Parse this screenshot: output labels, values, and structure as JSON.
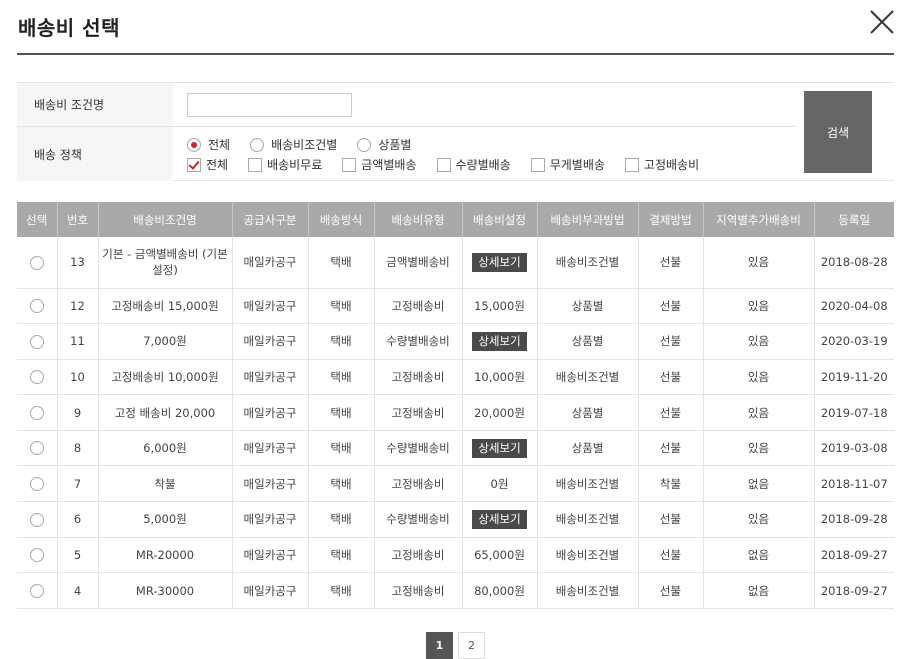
{
  "header": {
    "title": "배송비 선택"
  },
  "search": {
    "name_label": "배송비 조건명",
    "name_value": "",
    "policy_label": "배송 정책",
    "radios": [
      {
        "label": "전체",
        "checked": true
      },
      {
        "label": "배송비조건별",
        "checked": false
      },
      {
        "label": "상품별",
        "checked": false
      }
    ],
    "checks": [
      {
        "label": "전체",
        "checked": true
      },
      {
        "label": "배송비무료",
        "checked": false
      },
      {
        "label": "금액별배송",
        "checked": false
      },
      {
        "label": "수량별배송",
        "checked": false
      },
      {
        "label": "무게별배송",
        "checked": false
      },
      {
        "label": "고정배송비",
        "checked": false
      }
    ],
    "button_label": "검색"
  },
  "table": {
    "headers": [
      "선택",
      "번호",
      "배송비조건명",
      "공급사구분",
      "배송방식",
      "배송비유형",
      "배송비설정",
      "배송비부과방법",
      "결제방법",
      "지역별추가배송비",
      "등록일"
    ],
    "rows": [
      {
        "no": "13",
        "name": "기본 - 금액별배송비 (기본설정)",
        "supplier": "매일카공구",
        "method": "택배",
        "type": "금액별배송비",
        "setting": "상세보기",
        "is_button": true,
        "charge": "배송비조건별",
        "payment": "선불",
        "regional": "있음",
        "date": "2018-08-28"
      },
      {
        "no": "12",
        "name": "고정배송비 15,000원",
        "supplier": "매일카공구",
        "method": "택배",
        "type": "고정배송비",
        "setting": "15,000원",
        "is_button": false,
        "charge": "상품별",
        "payment": "선불",
        "regional": "있음",
        "date": "2020-04-08"
      },
      {
        "no": "11",
        "name": "7,000원",
        "supplier": "매일카공구",
        "method": "택배",
        "type": "수량별배송비",
        "setting": "상세보기",
        "is_button": true,
        "charge": "상품별",
        "payment": "선불",
        "regional": "있음",
        "date": "2020-03-19"
      },
      {
        "no": "10",
        "name": "고정배송비 10,000원",
        "supplier": "매일카공구",
        "method": "택배",
        "type": "고정배송비",
        "setting": "10,000원",
        "is_button": false,
        "charge": "배송비조건별",
        "payment": "선불",
        "regional": "있음",
        "date": "2019-11-20"
      },
      {
        "no": "9",
        "name": "고정 배송비 20,000",
        "supplier": "매일카공구",
        "method": "택배",
        "type": "고정배송비",
        "setting": "20,000원",
        "is_button": false,
        "charge": "상품별",
        "payment": "선불",
        "regional": "있음",
        "date": "2019-07-18"
      },
      {
        "no": "8",
        "name": "6,000원",
        "supplier": "매일카공구",
        "method": "택배",
        "type": "수량별배송비",
        "setting": "상세보기",
        "is_button": true,
        "charge": "상품별",
        "payment": "선불",
        "regional": "있음",
        "date": "2019-03-08"
      },
      {
        "no": "7",
        "name": "착불",
        "supplier": "매일카공구",
        "method": "택배",
        "type": "고정배송비",
        "setting": "0원",
        "is_button": false,
        "charge": "배송비조건별",
        "payment": "착불",
        "regional": "없음",
        "date": "2018-11-07"
      },
      {
        "no": "6",
        "name": "5,000원",
        "supplier": "매일카공구",
        "method": "택배",
        "type": "수량별배송비",
        "setting": "상세보기",
        "is_button": true,
        "charge": "배송비조건별",
        "payment": "선불",
        "regional": "있음",
        "date": "2018-09-28"
      },
      {
        "no": "5",
        "name": "MR-20000",
        "supplier": "매일카공구",
        "method": "택배",
        "type": "고정배송비",
        "setting": "65,000원",
        "is_button": false,
        "charge": "배송비조건별",
        "payment": "선불",
        "regional": "없음",
        "date": "2018-09-27"
      },
      {
        "no": "4",
        "name": "MR-30000",
        "supplier": "매일카공구",
        "method": "택배",
        "type": "고정배송비",
        "setting": "80,000원",
        "is_button": false,
        "charge": "배송비조건별",
        "payment": "선불",
        "regional": "없음",
        "date": "2018-09-27"
      }
    ]
  },
  "pagination": {
    "pages": [
      "1",
      "2"
    ],
    "current": "1"
  },
  "colors": {
    "header_bg": "#a9a9a9",
    "button_bg": "#666666",
    "detail_bg": "#4a4a4a",
    "accent_red": "#e02020"
  }
}
